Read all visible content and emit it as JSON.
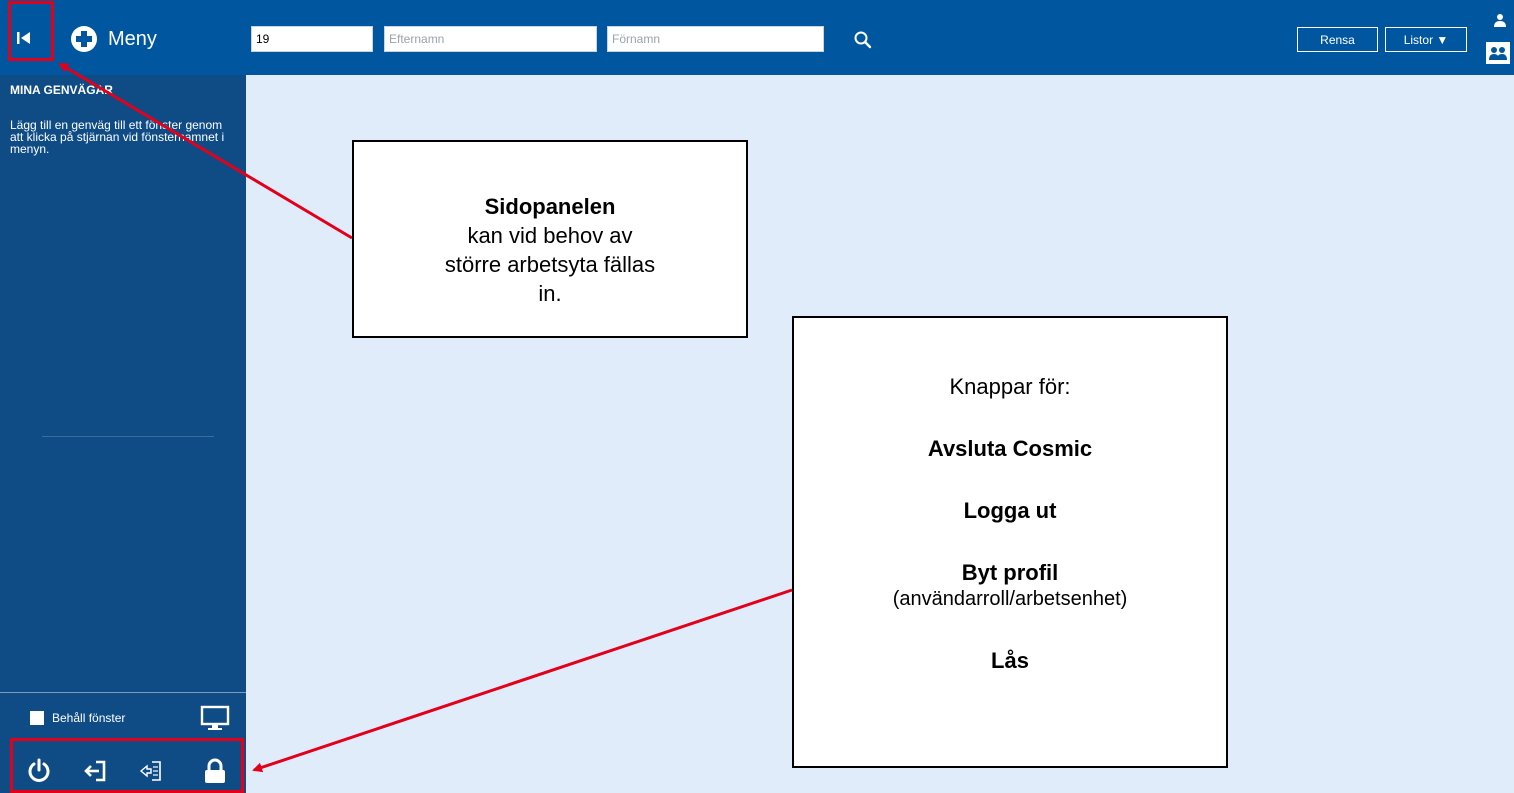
{
  "topbar": {
    "menu_label": "Meny",
    "search": {
      "personnummer_value": "19",
      "efternamn_placeholder": "Efternamn",
      "fornamn_placeholder": "Förnamn"
    },
    "rensa_label": "Rensa",
    "listor_label": "Listor ▼"
  },
  "sidebar": {
    "title": "MINA GENVÄGAR",
    "help_text": "Lägg till en genväg till ett fönster genom att klicka på stjärnan vid fönsternamnet i menyn.",
    "keep_windows_label": "Behåll fönster"
  },
  "callouts": {
    "sidopanel_title": "Sidopanelen",
    "sidopanel_text": "kan vid behov av större arbetsyta fällas in.",
    "buttons_intro": "Knappar för:",
    "item_quit": "Avsluta Cosmic",
    "item_logout": "Logga ut",
    "item_switch_profile": "Byt profil",
    "item_switch_profile_note": "(användarroll/arbetsenhet)",
    "item_lock": "Lås"
  },
  "colors": {
    "topbar_bg": "#0057a0",
    "sidebar_bg": "#0f4c86",
    "workspace_bg": "#e0ecfa",
    "highlight_red": "#e2001a"
  }
}
